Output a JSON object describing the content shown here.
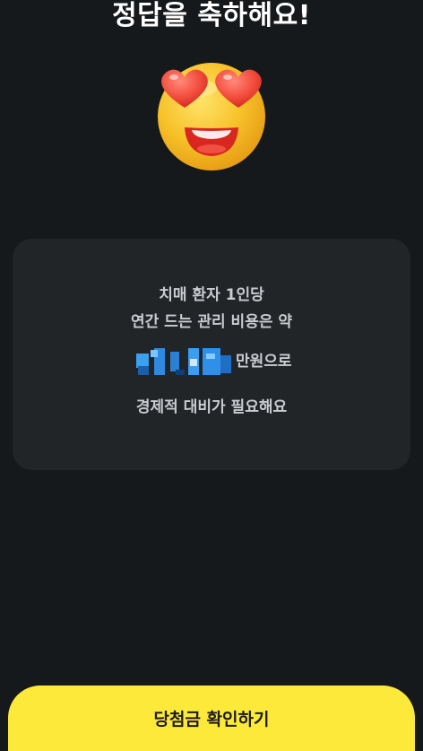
{
  "header": {
    "title": "정답을 축하해요!"
  },
  "emoji": {
    "icon": "heart-eyes-emoji-icon",
    "face_color": "#f5b91f",
    "heart_color": "#f24a3b"
  },
  "result_card": {
    "line1": "치매 환자 1인당",
    "line2": "연간 드는 관리 비용은 약",
    "amount_unit": "만원으로",
    "line4": "경제적 대비가 필요해요"
  },
  "cta": {
    "label": "당첨금 확인하기",
    "color": "#fde939"
  }
}
